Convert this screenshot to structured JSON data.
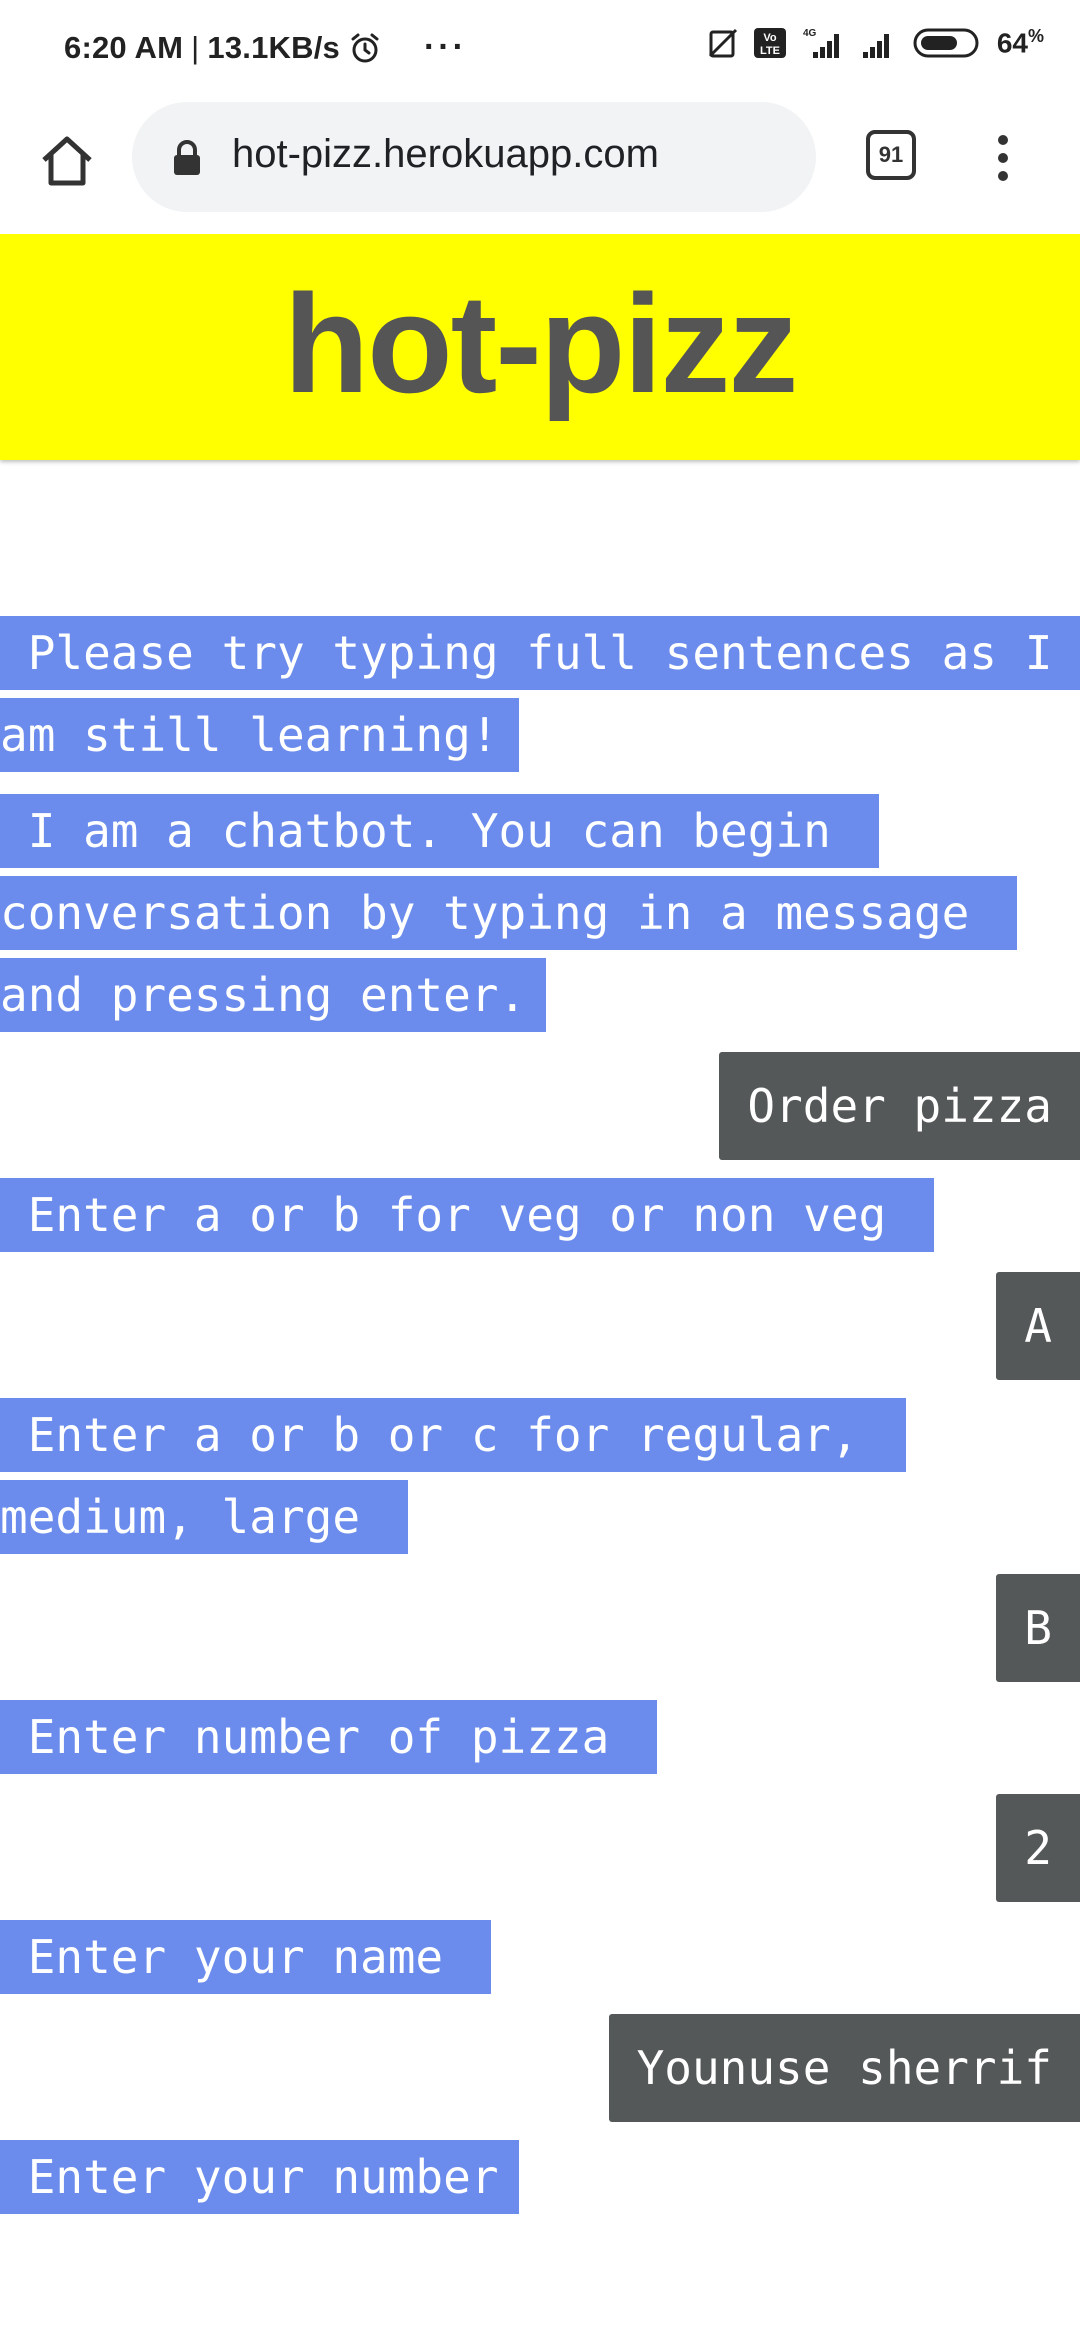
{
  "status_bar": {
    "time": "6:20 AM",
    "speed": "13.1KB/s",
    "more": "···",
    "network": "4G",
    "battery_percent": "64"
  },
  "browser": {
    "url": "hot-pizz.herokuapp.com",
    "tab_count": "91"
  },
  "page": {
    "title": "hot-pizz"
  },
  "chat": {
    "messages": [
      {
        "from": "bot",
        "text": " Please try typing full sentences as I am still learning!"
      },
      {
        "from": "bot",
        "text": " I am a chatbot. You can begin conversation by typing in a message and pressing enter."
      },
      {
        "from": "user",
        "text": "Order pizza"
      },
      {
        "from": "bot",
        "text": " Enter a or b for veg or non veg "
      },
      {
        "from": "user",
        "text": "A"
      },
      {
        "from": "bot",
        "text": " Enter a or b or c for regular, medium, large "
      },
      {
        "from": "user",
        "text": "B"
      },
      {
        "from": "bot",
        "text": " Enter number of pizza "
      },
      {
        "from": "user",
        "text": "2"
      },
      {
        "from": "bot",
        "text": " Enter your name "
      },
      {
        "from": "user",
        "text": "Younuse sherrif"
      },
      {
        "from": "bot",
        "text": " Enter your number"
      }
    ]
  },
  "colors": {
    "header_bg": "#ffff00",
    "title_text": "#555555",
    "bot_bubble": "#6b8cec",
    "user_bubble": "#555859"
  }
}
